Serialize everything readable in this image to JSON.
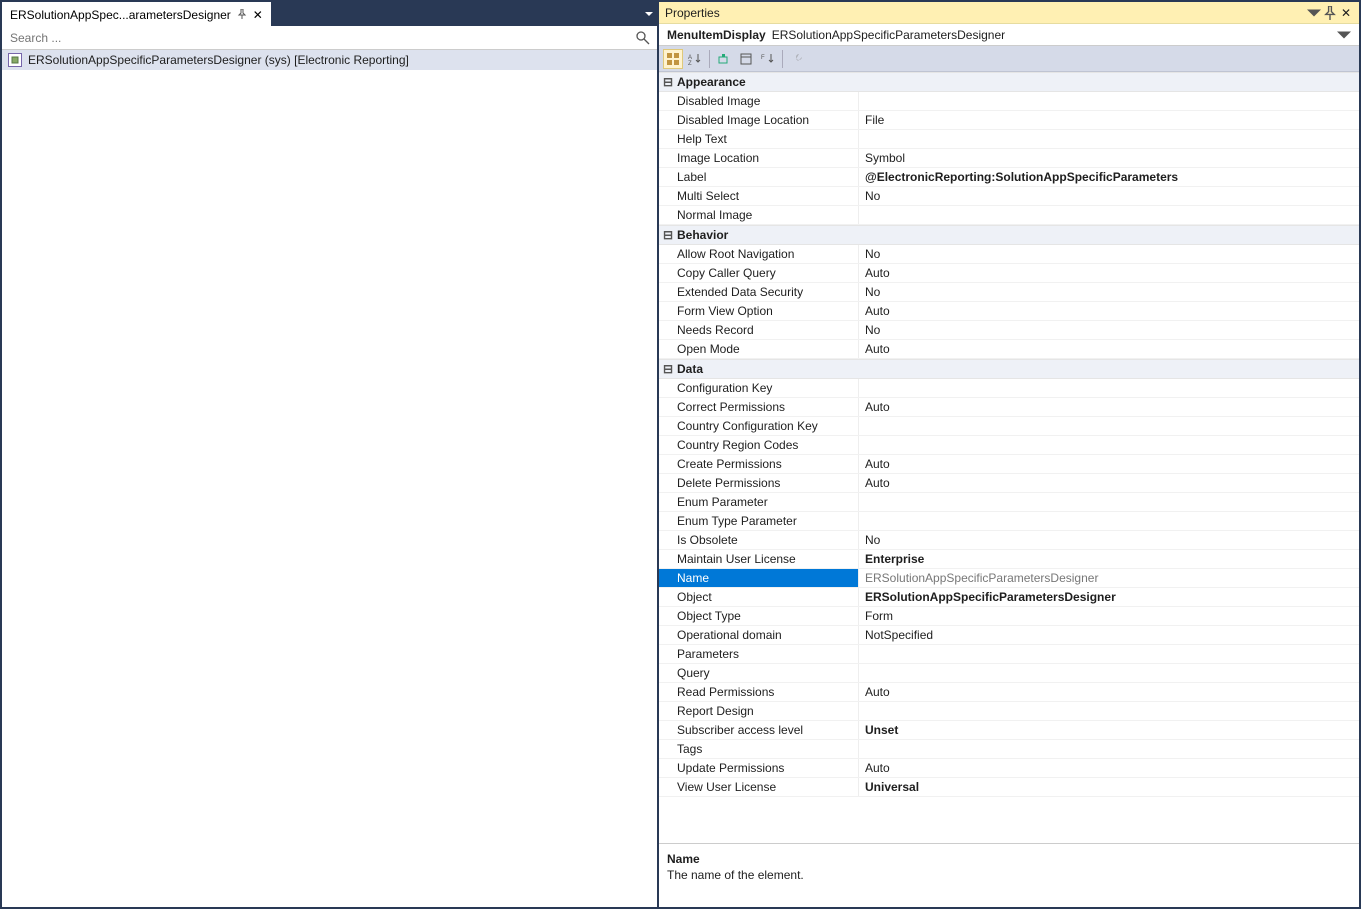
{
  "tab": {
    "label": "ERSolutionAppSpec...arametersDesigner"
  },
  "search": {
    "placeholder": "Search ..."
  },
  "tree": {
    "item": "ERSolutionAppSpecificParametersDesigner (sys) [Electronic Reporting]"
  },
  "properties": {
    "title": "Properties",
    "object_type": "MenuItemDisplay",
    "object_name": "ERSolutionAppSpecificParametersDesigner",
    "categories": [
      {
        "name": "Appearance",
        "props": [
          {
            "k": "Disabled Image",
            "v": ""
          },
          {
            "k": "Disabled Image Location",
            "v": "File"
          },
          {
            "k": "Help Text",
            "v": ""
          },
          {
            "k": "Image Location",
            "v": "Symbol"
          },
          {
            "k": "Label",
            "v": "@ElectronicReporting:SolutionAppSpecificParameters",
            "bold": true
          },
          {
            "k": "Multi Select",
            "v": "No"
          },
          {
            "k": "Normal Image",
            "v": ""
          }
        ]
      },
      {
        "name": "Behavior",
        "props": [
          {
            "k": "Allow Root Navigation",
            "v": "No"
          },
          {
            "k": "Copy Caller Query",
            "v": "Auto"
          },
          {
            "k": "Extended Data Security",
            "v": "No"
          },
          {
            "k": "Form View Option",
            "v": "Auto"
          },
          {
            "k": "Needs Record",
            "v": "No"
          },
          {
            "k": "Open Mode",
            "v": "Auto"
          }
        ]
      },
      {
        "name": "Data",
        "props": [
          {
            "k": "Configuration Key",
            "v": ""
          },
          {
            "k": "Correct Permissions",
            "v": "Auto"
          },
          {
            "k": "Country Configuration Key",
            "v": ""
          },
          {
            "k": "Country Region Codes",
            "v": ""
          },
          {
            "k": "Create Permissions",
            "v": "Auto"
          },
          {
            "k": "Delete Permissions",
            "v": "Auto"
          },
          {
            "k": "Enum Parameter",
            "v": ""
          },
          {
            "k": "Enum Type Parameter",
            "v": ""
          },
          {
            "k": "Is Obsolete",
            "v": "No"
          },
          {
            "k": "Maintain User License",
            "v": "Enterprise",
            "bold": true
          },
          {
            "k": "Name",
            "v": "ERSolutionAppSpecificParametersDesigner",
            "selected": true
          },
          {
            "k": "Object",
            "v": "ERSolutionAppSpecificParametersDesigner",
            "bold": true
          },
          {
            "k": "Object Type",
            "v": "Form"
          },
          {
            "k": "Operational domain",
            "v": "NotSpecified"
          },
          {
            "k": "Parameters",
            "v": ""
          },
          {
            "k": "Query",
            "v": ""
          },
          {
            "k": "Read Permissions",
            "v": "Auto"
          },
          {
            "k": "Report Design",
            "v": ""
          },
          {
            "k": "Subscriber access level",
            "v": "Unset",
            "bold": true
          },
          {
            "k": "Tags",
            "v": ""
          },
          {
            "k": "Update Permissions",
            "v": "Auto"
          },
          {
            "k": "View User License",
            "v": "Universal",
            "bold": true
          }
        ]
      }
    ],
    "description": {
      "title": "Name",
      "text": "The name of the element."
    }
  }
}
